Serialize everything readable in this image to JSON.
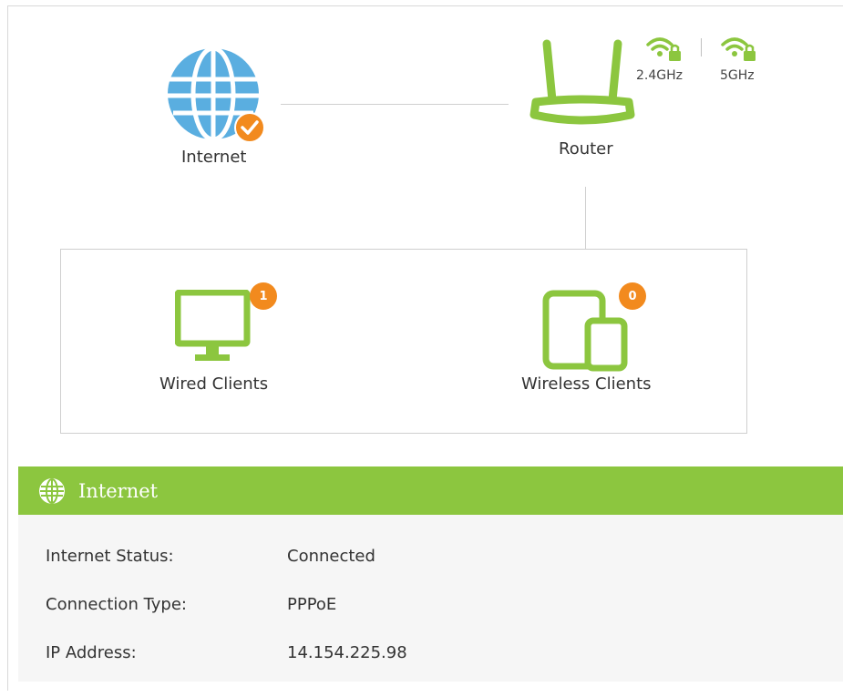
{
  "topology": {
    "internet": {
      "label": "Internet",
      "status": "connected"
    },
    "router": {
      "label": "Router",
      "bands": [
        "2.4GHz",
        "5GHz"
      ]
    },
    "clients": {
      "wired": {
        "label": "Wired Clients",
        "count": "1"
      },
      "wireless": {
        "label": "Wireless Clients",
        "count": "0"
      }
    }
  },
  "internet_section": {
    "title": "Internet",
    "rows": [
      {
        "key": "Internet Status:",
        "value": "Connected"
      },
      {
        "key": "Connection Type:",
        "value": "PPPoE"
      },
      {
        "key": "IP Address:",
        "value": "14.154.225.98"
      }
    ]
  },
  "colors": {
    "accent_green": "#8cc63f",
    "globe_blue": "#5aaee0",
    "badge_orange": "#f28a1e"
  },
  "icons": [
    "globe-icon",
    "check-icon",
    "router-icon",
    "wifi-lock-icon",
    "monitor-icon",
    "devices-icon"
  ]
}
